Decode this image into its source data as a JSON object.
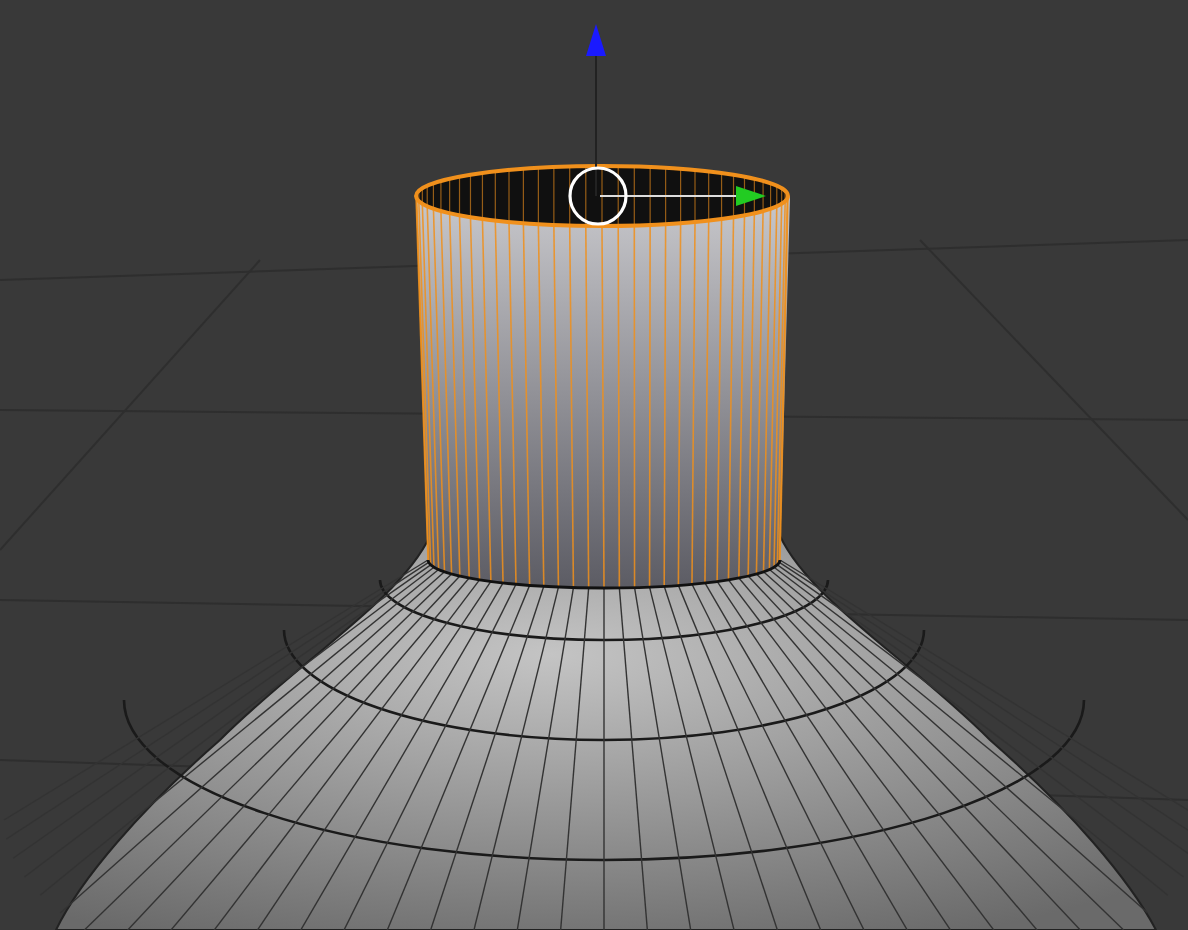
{
  "viewport": {
    "kind": "mesh-edit"
  }
}
